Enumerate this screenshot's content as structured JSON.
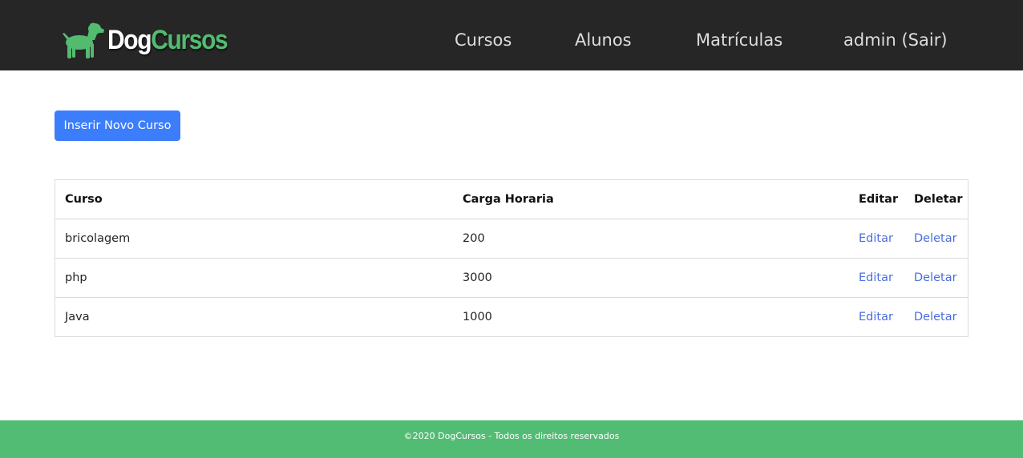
{
  "brand": {
    "name_part1": "Dog",
    "name_part2": "Cursos",
    "logo_icon": "dog-icon",
    "accent_color": "#52bb70"
  },
  "nav": {
    "items": [
      {
        "label": "Cursos"
      },
      {
        "label": "Alunos"
      },
      {
        "label": "Matrículas"
      },
      {
        "label": "admin (Sair)"
      }
    ]
  },
  "actions": {
    "insert_label": "Inserir Novo Curso",
    "button_color": "#3b7dfb"
  },
  "table": {
    "headers": [
      "Curso",
      "Carga Horaria",
      "Editar",
      "Deletar"
    ],
    "rows": [
      {
        "curso": "bricolagem",
        "carga": "200",
        "editar": "Editar",
        "deletar": "Deletar"
      },
      {
        "curso": "php",
        "carga": "3000",
        "editar": "Editar",
        "deletar": "Deletar"
      },
      {
        "curso": "Java",
        "carga": "1000",
        "editar": "Editar",
        "deletar": "Deletar"
      }
    ]
  },
  "footer": {
    "text": "©2020 DogCursos - Todos os direitos reservados",
    "background_color": "#53bc74"
  }
}
